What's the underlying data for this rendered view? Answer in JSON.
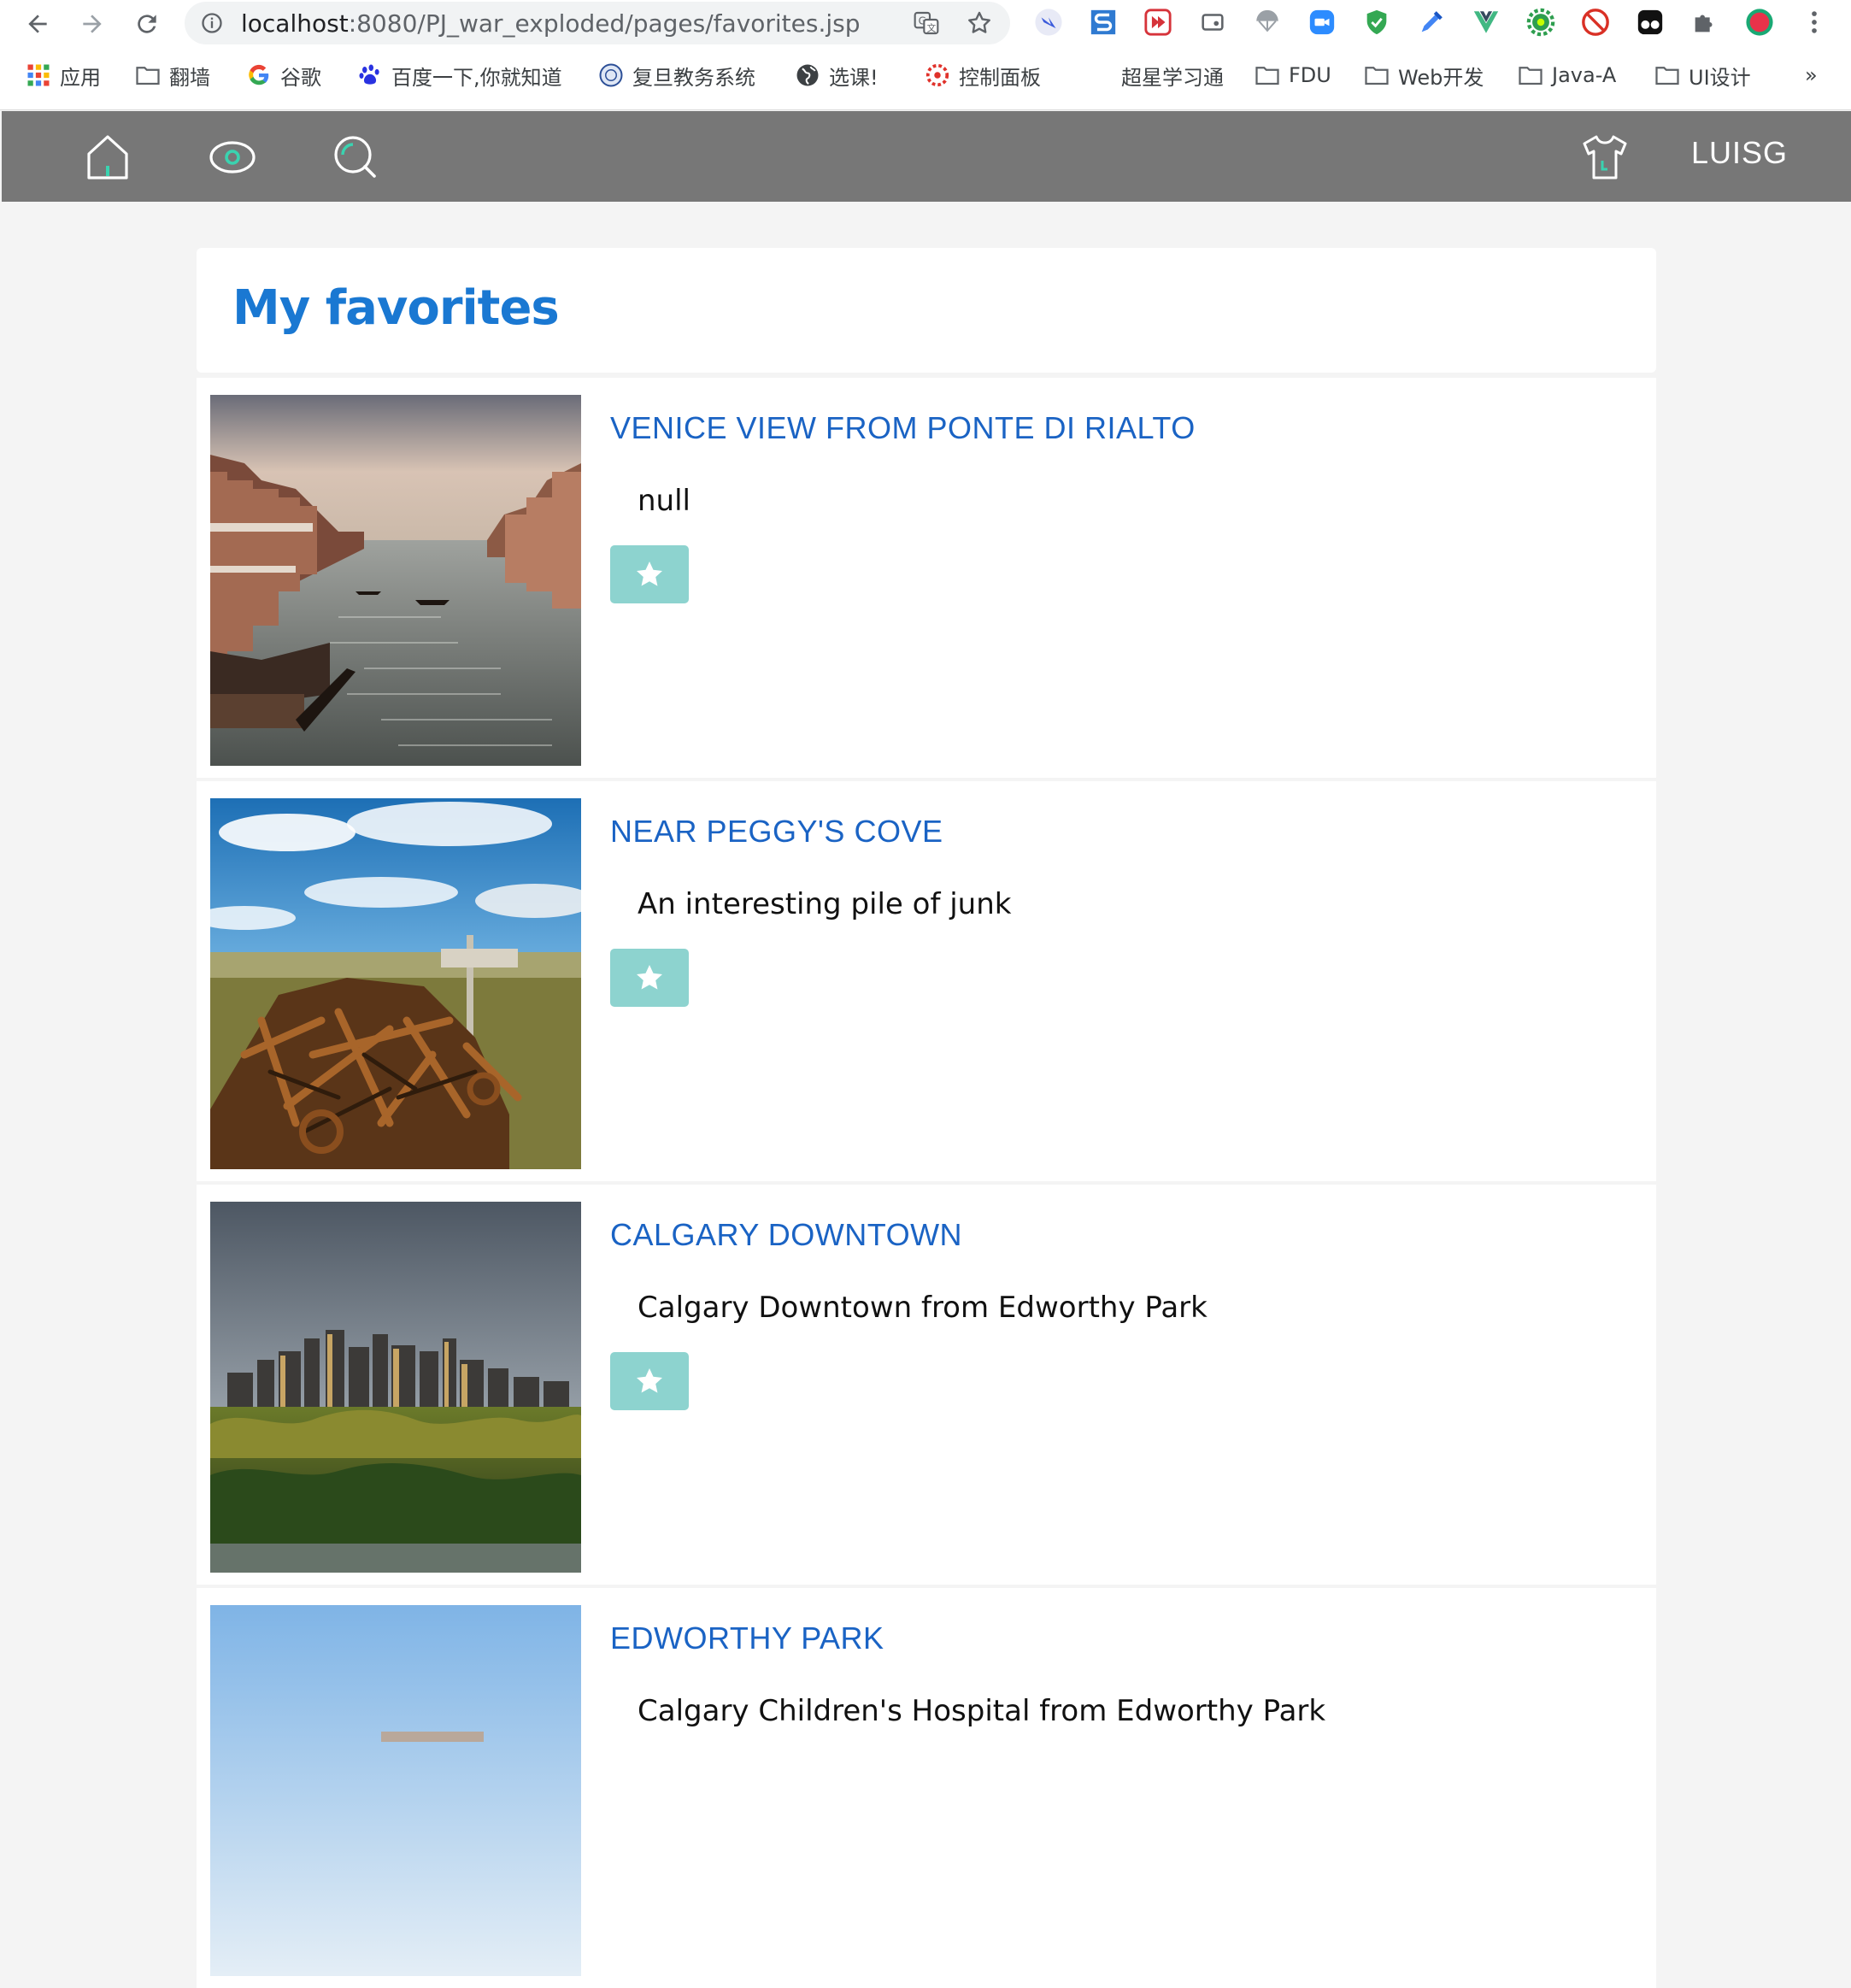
{
  "browser": {
    "url_host": "localhost",
    "url_path": ":8080/PJ_war_exploded/pages/favorites.jsp",
    "bookmarks": [
      {
        "label": "应用",
        "icon": "apps-grid-icon"
      },
      {
        "label": "翻墙",
        "icon": "folder-icon"
      },
      {
        "label": "谷歌",
        "icon": "google-icon"
      },
      {
        "label": "百度一下,你就知道",
        "icon": "baidu-paw-icon"
      },
      {
        "label": "复旦教务系统",
        "icon": "fudan-seal-icon"
      },
      {
        "label": "选课!",
        "icon": "globe-icon"
      },
      {
        "label": "控制面板",
        "icon": "gear-red-icon"
      },
      {
        "label": "超星学习通",
        "icon": ""
      },
      {
        "label": "FDU",
        "icon": "folder-icon"
      },
      {
        "label": "Web开发",
        "icon": "folder-icon"
      },
      {
        "label": "Java-A",
        "icon": "folder-icon"
      },
      {
        "label": "UI设计",
        "icon": "folder-icon"
      }
    ],
    "more_bookmarks": "»"
  },
  "site_nav": {
    "username": "LUISG",
    "icons": [
      "home-icon",
      "eye-icon",
      "search-icon",
      "tshirt-icon"
    ]
  },
  "page": {
    "title": "My favorites"
  },
  "favorites": [
    {
      "title": "Venice View from Ponte di Rialto",
      "description": "null",
      "image": "venice-canal-photo"
    },
    {
      "title": "Near Peggy's Cove",
      "description": "An interesting pile of junk",
      "image": "rusty-junk-photo"
    },
    {
      "title": "Calgary Downtown",
      "description": "Calgary Downtown from Edworthy Park",
      "image": "calgary-skyline-photo"
    },
    {
      "title": "Edworthy Park",
      "description": "Calgary Children's Hospital from Edworthy Park",
      "image": "hospital-park-photo"
    }
  ],
  "colors": {
    "nav_bg": "#777777",
    "title_blue": "#1a78d2",
    "card_title_blue": "#1a63c4",
    "fav_button": "#8dd3cf",
    "page_bg": "#f4f4f4"
  }
}
